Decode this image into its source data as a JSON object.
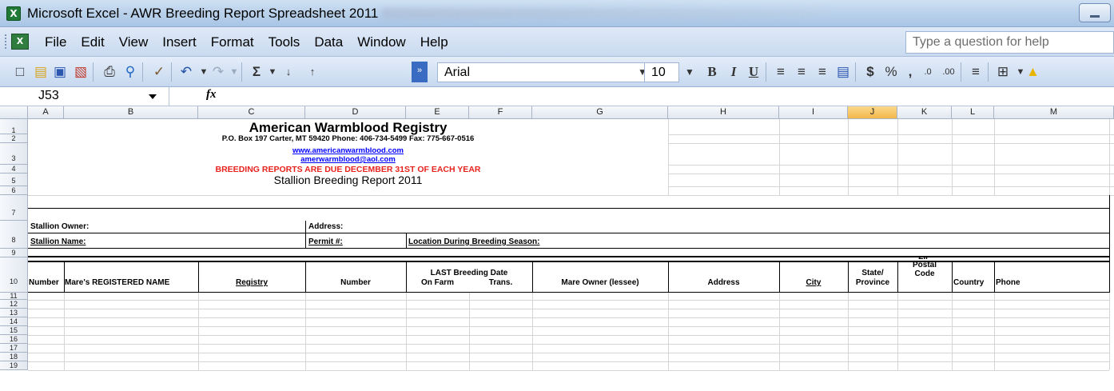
{
  "window": {
    "title": "Microsoft Excel - AWR Breeding Report Spreadsheet 2011"
  },
  "menu": {
    "items": [
      "File",
      "Edit",
      "View",
      "Insert",
      "Format",
      "Tools",
      "Data",
      "Window",
      "Help"
    ],
    "help_placeholder": "Type a question for help"
  },
  "toolbar": {
    "font_name": "Arial",
    "font_size": "10"
  },
  "formula_bar": {
    "name_box": "J53",
    "fx_label": "fx",
    "content": ""
  },
  "sheet": {
    "columns": [
      "A",
      "B",
      "C",
      "D",
      "E",
      "F",
      "G",
      "H",
      "I",
      "J",
      "K",
      "L",
      "M"
    ],
    "selected_column": "J",
    "rows": [
      "1",
      "2",
      "3",
      "4",
      "5",
      "6",
      "7",
      "8",
      "9",
      "10",
      "11",
      "12",
      "13",
      "14",
      "15",
      "16",
      "17",
      "18",
      "19"
    ],
    "heading": "American Warmblood Registry",
    "address_line": "P.O. Box 197  Carter, MT 59420  Phone:  406-734-5499  Fax:  775-667-0516",
    "website": "www.americanwarmblood.com",
    "email": "amerwarmblood@aol.com",
    "due_notice": "BREEDING REPORTS ARE DUE DECEMBER 31ST OF EACH YEAR",
    "report_title": "Stallion Breeding Report 2011",
    "stallion_owner": "Stallion Owner:",
    "address_label": "Address:",
    "stallion_name": "Stallion Name:",
    "permit": "Permit #:",
    "location": "Location During Breeding Season:",
    "headers": {
      "number": "Number",
      "mare_name": "Mare's REGISTERED NAME",
      "registry": "Registry",
      "number2": "Number",
      "last_breeding": "LAST Breeding Date",
      "on_farm": "On Farm",
      "trans": "Trans.",
      "mare_owner": "Mare Owner (lessee)",
      "address": "Address",
      "city": "City",
      "state": "State/",
      "province": "Province",
      "zip_partial": "ZIP",
      "postal": "Postal",
      "code": "Code",
      "country": "Country",
      "phone": "Phone"
    }
  },
  "colors": {
    "accent_red": "#e8231e",
    "link_blue": "#0000ff",
    "selected_col": "#f3b74c"
  }
}
